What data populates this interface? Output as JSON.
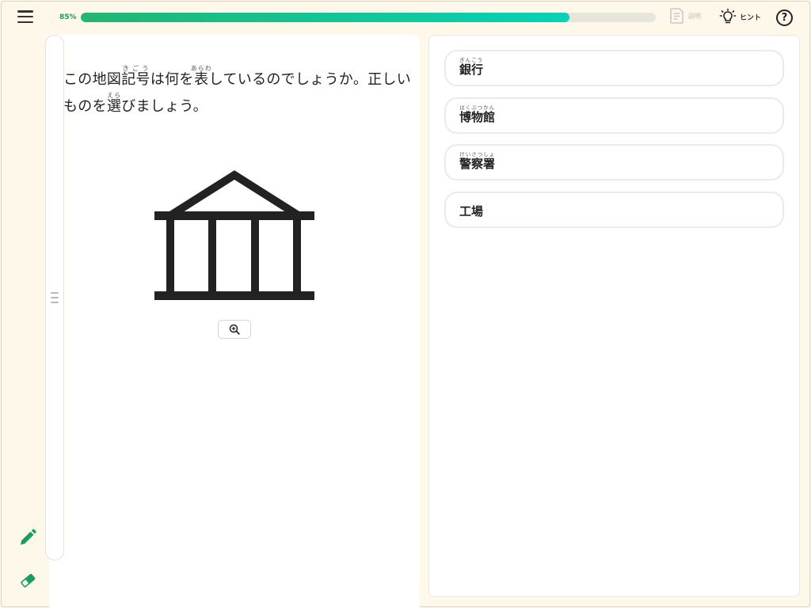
{
  "progress": {
    "label": "85%",
    "value": 0.85
  },
  "toolbar": {
    "explain_label": "説明",
    "hint_label": "ヒント",
    "help_label": "?"
  },
  "question": {
    "parts": [
      {
        "t": "この地図"
      },
      {
        "t": "記号",
        "r": "きごう"
      },
      {
        "t": "は何を"
      },
      {
        "t": "表",
        "r": "あらわ"
      },
      {
        "t": "しているのでしょうか。正しいものを"
      },
      {
        "t": "選",
        "r": "えら"
      },
      {
        "t": "びましょう。"
      }
    ]
  },
  "choices": [
    {
      "text": "銀行",
      "ruby": "ぎんこう"
    },
    {
      "text": "博物館",
      "ruby": "はくぶつかん"
    },
    {
      "text": "警察署",
      "ruby": "けいさつしょ"
    },
    {
      "text": "工場",
      "ruby": ""
    }
  ],
  "icons": {
    "menu": "hamburger-menu-icon",
    "explain": "document-icon",
    "hint": "lightbulb-icon",
    "help": "question-circle-icon",
    "pencil": "pencil-icon",
    "eraser": "eraser-icon",
    "zoom": "zoom-in-icon",
    "grip": "drag-handle-icon"
  },
  "colors": {
    "accent": "#1b9c5e",
    "progress_start": "#22b573",
    "progress_end": "#05d3b6",
    "background": "#fdf8ea"
  }
}
